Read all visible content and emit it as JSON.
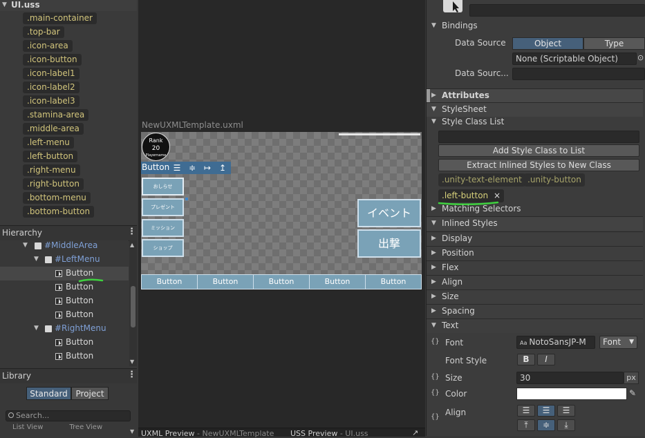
{
  "uss_panel": {
    "file": "UI.uss",
    "selectors": [
      ".main-container",
      ".top-bar",
      ".icon-area",
      ".icon-button",
      ".icon-label1",
      ".icon-label2",
      ".icon-label3",
      ".stamina-area",
      ".middle-area",
      ".left-menu",
      ".left-button",
      ".right-menu",
      ".right-button",
      ".bottom-menu",
      ".bottom-button"
    ]
  },
  "hierarchy": {
    "title": "Hierarchy",
    "items": [
      {
        "label": "#MiddleArea"
      },
      {
        "label": "#LeftMenu"
      },
      {
        "label": "Button"
      },
      {
        "label": "Button"
      },
      {
        "label": "Button"
      },
      {
        "label": "Button"
      },
      {
        "label": "#RightMenu"
      },
      {
        "label": "Button"
      },
      {
        "label": "Button"
      }
    ]
  },
  "library": {
    "title": "Library",
    "tabs": [
      "Standard",
      "Project"
    ],
    "search_placeholder": "Search...",
    "cutoff_tabs": [
      "List View",
      "Tree View"
    ]
  },
  "canvas": {
    "title": "NewUXMLTemplate.uxml",
    "rank": {
      "label": "Rank",
      "value": "20",
      "name": "Playername"
    },
    "toolbar_label": "Button",
    "left_buttons": [
      "おしらせ",
      "プレゼント",
      "ミッション",
      "ショップ"
    ],
    "right_buttons": [
      "イベント",
      "出撃"
    ],
    "bottom_buttons": [
      "Button",
      "Button",
      "Button",
      "Button",
      "Button"
    ]
  },
  "center_tabs": [
    {
      "label": "UXML Preview",
      "sub": "- NewUXMLTemplate"
    },
    {
      "label": "USS Preview",
      "sub": "- UI.uss"
    }
  ],
  "inspector": {
    "bindings_title": "Bindings",
    "data_source_label": "Data Source",
    "data_source_tabs": [
      "Object",
      "Type"
    ],
    "data_source_value": "None (Scriptable Object)",
    "data_source_path_label": "Data Sourc...",
    "sections": {
      "attributes": "Attributes",
      "stylesheet": "StyleSheet",
      "style_class_list": "Style Class List",
      "matching_selectors": "Matching Selectors",
      "inlined_styles": "Inlined Styles",
      "display": "Display",
      "position": "Position",
      "flex": "Flex",
      "align": "Align",
      "size": "Size",
      "spacing": "Spacing",
      "text": "Text"
    },
    "add_class_button": "Add Style Class to List",
    "extract_button": "Extract Inlined Styles to New Class",
    "inherited_classes": [
      ".unity-text-element",
      ".unity-button"
    ],
    "applied_class": ".left-button",
    "text": {
      "font_label": "Font",
      "font_value": "NotoSansJP-M",
      "font_dropdown": "Font",
      "font_style_label": "Font Style",
      "bold_glyph": "B",
      "italic_glyph": "I",
      "size_label": "Size",
      "size_value": "30",
      "size_unit": "px",
      "color_label": "Color",
      "color_value": "#ffffff",
      "align_label": "Align"
    }
  },
  "colors": {
    "accent_selection": "#46607a",
    "annotation": "#3fd13f",
    "canvas_button": "#7aa2b7"
  }
}
